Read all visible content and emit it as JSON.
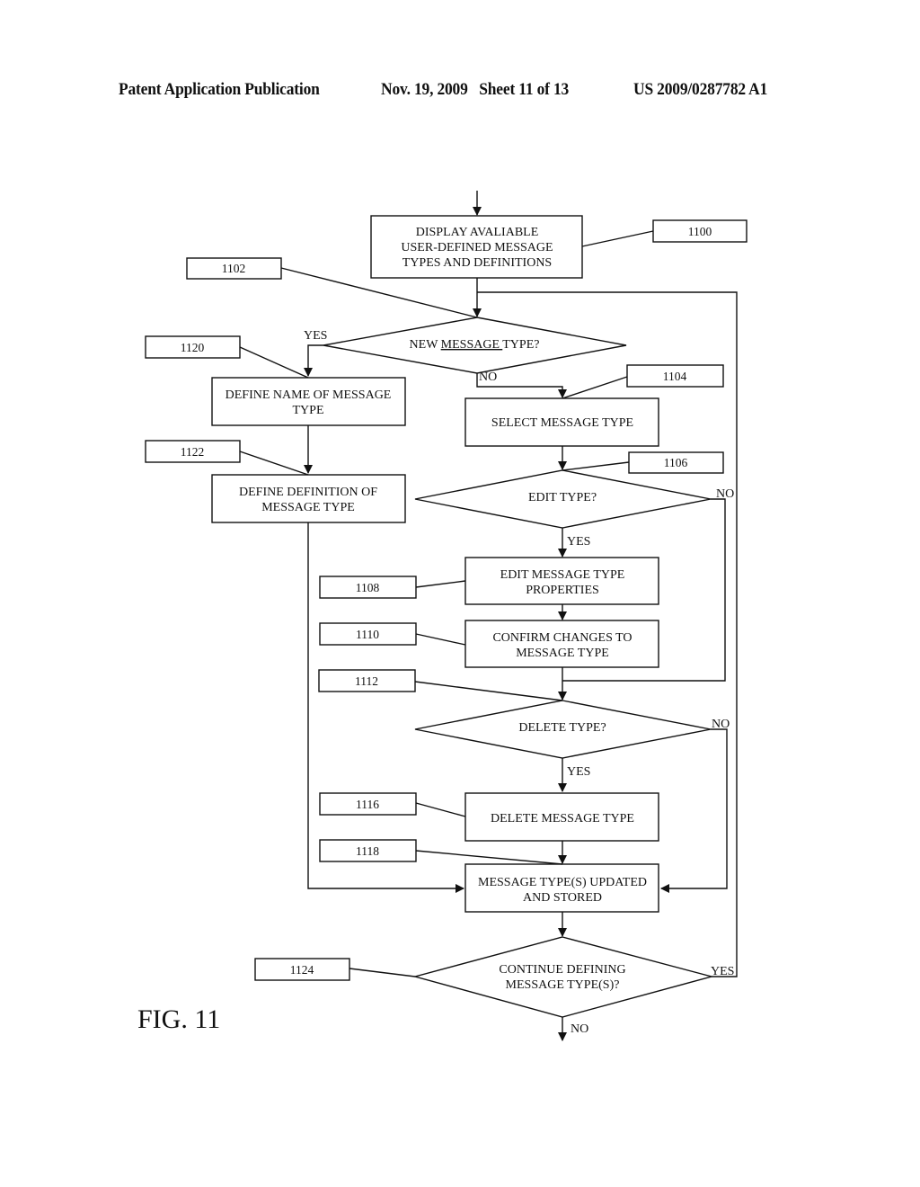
{
  "header": {
    "publication": "Patent Application Publication",
    "date_sheet": "Nov. 19, 2009   Sheet 11 of 13",
    "number": "US 2009/0287782 A1"
  },
  "figure_label": "FIG. 11",
  "steps": {
    "s1100": {
      "ref": "1100",
      "lines": [
        "DISPLAY AVALIABLE",
        "USER-DEFINED MESSAGE",
        "TYPES AND DEFINITIONS"
      ]
    },
    "s1102": {
      "ref": "1102",
      "pre": "NEW ",
      "underlined": "MESSAGE ",
      "post": "TYPE?"
    },
    "s1104": {
      "ref": "1104",
      "lines": [
        "SELECT MESSAGE TYPE"
      ]
    },
    "s1106": {
      "ref": "1106",
      "lines": [
        "EDIT TYPE?"
      ]
    },
    "s1108": {
      "ref": "1108",
      "lines": [
        "EDIT MESSAGE TYPE",
        "PROPERTIES"
      ]
    },
    "s1110": {
      "ref": "1110",
      "lines": [
        "CONFIRM  CHANGES TO",
        "MESSAGE TYPE"
      ]
    },
    "s1112": {
      "ref": "1112",
      "lines": [
        "DELETE TYPE?"
      ]
    },
    "s1116": {
      "ref": "1116",
      "lines": [
        "DELETE MESSAGE TYPE"
      ]
    },
    "s1118": {
      "ref": "1118",
      "lines": [
        "MESSAGE TYPE(S) UPDATED",
        "AND STORED"
      ]
    },
    "s1120": {
      "ref": "1120",
      "lines": [
        "DEFINE NAME OF MESSAGE",
        "TYPE"
      ]
    },
    "s1122": {
      "ref": "1122",
      "lines": [
        "DEFINE DEFINITION OF",
        "MESSAGE TYPE"
      ]
    },
    "s1124": {
      "ref": "1124",
      "lines": [
        "CONTINUE DEFINING",
        "MESSAGE TYPE(S)?"
      ]
    }
  },
  "branch_labels": {
    "yes": "YES",
    "no": "NO"
  }
}
